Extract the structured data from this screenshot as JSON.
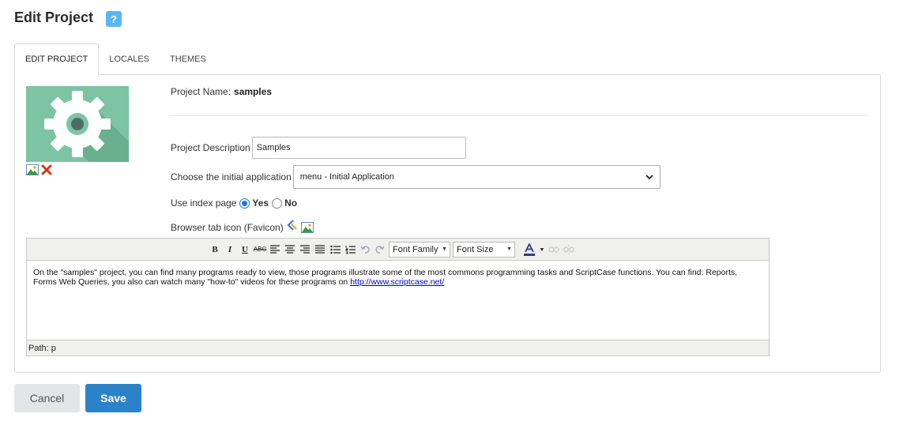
{
  "page": {
    "title": "Edit Project",
    "help_label": "?"
  },
  "tabs": [
    {
      "label": "EDIT PROJECT",
      "active": true
    },
    {
      "label": "LOCALES",
      "active": false
    },
    {
      "label": "THEMES",
      "active": false
    }
  ],
  "form": {
    "project_name_label": "Project Name:",
    "project_name_value": "samples",
    "description_label": "Project Description",
    "description_value": "Samples",
    "initial_app_label": "Choose the initial application",
    "initial_app_value": "menu - Initial Application",
    "index_page_label": "Use index page",
    "index_yes_label": "Yes",
    "index_no_label": "No",
    "index_selected": "Yes",
    "favicon_label": "Browser tab icon (Favicon)"
  },
  "editor": {
    "font_family_label": "Font Family",
    "font_size_label": "Font Size",
    "content_text": "On the \"samples\" project, you can find many programs ready to view, those programs illustrate some of the most commons programming tasks and ScriptCase functions. You can find: Reports, Forms Web Queries, you also can watch many \"how-to\" videos for these programs on ",
    "content_link": "http://www.scriptcase.net/",
    "status_path": "Path: p"
  },
  "buttons": {
    "cancel_label": "Cancel",
    "save_label": "Save"
  },
  "colors": {
    "save": "#2c82c9",
    "thumb_bg": "#7cc4a4",
    "help": "#5bb7f0"
  }
}
